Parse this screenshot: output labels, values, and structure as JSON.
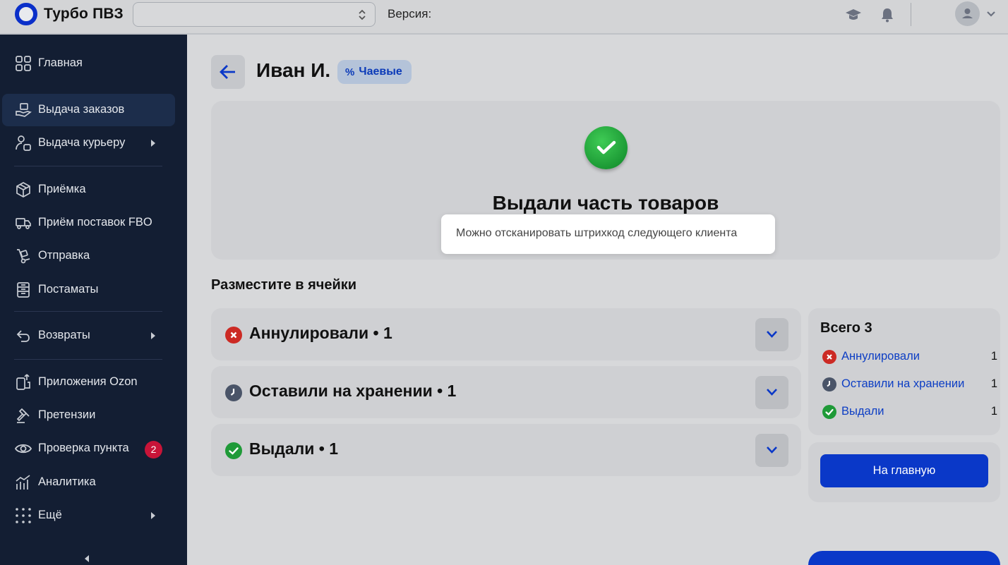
{
  "app": {
    "title": "Турбо ПВЗ",
    "version_label": "Версия:",
    "branch_select_value": ""
  },
  "topbar": {
    "icons": [
      "graduation-cap-icon",
      "bell-icon",
      "user-avatar-icon",
      "chevron-down-icon"
    ]
  },
  "sidebar": {
    "items": [
      {
        "label": "Главная",
        "icon": "grid-icon"
      },
      {
        "label": "Выдача заказов",
        "icon": "hand-box-icon",
        "active": true
      },
      {
        "label": "Выдача курьеру",
        "icon": "courier-icon",
        "submenu": true
      },
      {
        "label": "Приёмка",
        "icon": "package-icon"
      },
      {
        "label": "Приём поставок FBO",
        "icon": "truck-icon"
      },
      {
        "label": "Отправка",
        "icon": "dolly-icon"
      },
      {
        "label": "Постаматы",
        "icon": "locker-icon"
      },
      {
        "label": "Возвраты",
        "icon": "return-arrow-icon",
        "submenu": true
      },
      {
        "label": "Приложения Ozon",
        "icon": "apps-icon"
      },
      {
        "label": "Претензии",
        "icon": "gavel-icon"
      },
      {
        "label": "Проверка пункта",
        "icon": "eye-icon",
        "badge": "2"
      },
      {
        "label": "Аналитика",
        "icon": "chart-icon"
      },
      {
        "label": "Ещё",
        "icon": "dots-grid-icon",
        "submenu": true
      }
    ]
  },
  "header": {
    "client_name": "Иван И.",
    "tips_badge": "Чаевые"
  },
  "result": {
    "title": "Выдали часть товаров",
    "tooltip": "Можно отсканировать штрихкод следующего клиента"
  },
  "cells": {
    "section_title": "Разместите в ячейки",
    "groups": [
      {
        "label": "Аннулировали • 1",
        "status": "cancelled",
        "color": "#cc2a24"
      },
      {
        "label": "Оставили на хранении • 1",
        "status": "stored",
        "color": "#4a5468"
      },
      {
        "label": "Выдали • 1",
        "status": "issued",
        "color": "#1f9a38"
      }
    ]
  },
  "summary": {
    "title": "Всего 3",
    "rows": [
      {
        "label": "Аннулировали",
        "count": "1",
        "color": "#cc2a24"
      },
      {
        "label": "Оставили на хранении",
        "count": "1",
        "color": "#4a5468"
      },
      {
        "label": "Выдали",
        "count": "1",
        "color": "#1f9a38"
      }
    ],
    "home_button": "На главную"
  }
}
